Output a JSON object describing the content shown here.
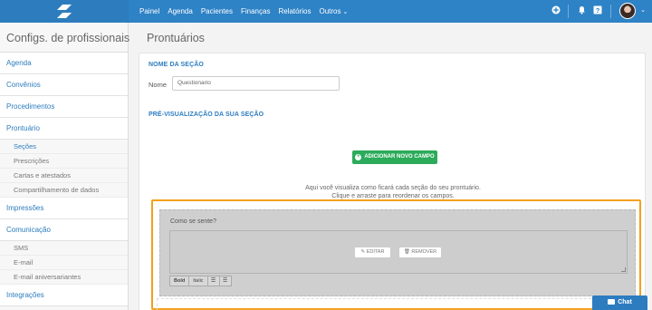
{
  "nav": {
    "items": [
      "Painel",
      "Agenda",
      "Pacientes",
      "Finanças",
      "Relatórios"
    ],
    "more_label": "Outros",
    "icons": [
      "plus-circle-icon",
      "bell-icon",
      "help-icon"
    ]
  },
  "sidebar": {
    "title": "Configs. de profissionais",
    "items": [
      {
        "label": "Agenda"
      },
      {
        "label": "Convênios"
      },
      {
        "label": "Procedimentos"
      },
      {
        "label": "Prontuário"
      },
      {
        "label": "Seções"
      },
      {
        "label": "Prescrições"
      },
      {
        "label": "Cartas e atestados"
      },
      {
        "label": "Compartilhamento de dados"
      },
      {
        "label": "Impressões"
      },
      {
        "label": "Comunicação"
      },
      {
        "label": "SMS"
      },
      {
        "label": "E-mail"
      },
      {
        "label": "E-mail aniversariantes"
      },
      {
        "label": "Integrações"
      }
    ]
  },
  "main": {
    "title": "Prontuários",
    "section_name_heading": "NOME DA SEÇÃO",
    "name_label": "Nome",
    "name_value": "Questionario",
    "preview_heading": "PRÉ-VISUALIZAÇÃO DA SUA SEÇÃO",
    "add_field_button": "ADICIONAR NOVO CAMPO",
    "hint_line1": "Aqui você visualiza como ficará cada seção do seu prontuário.",
    "hint_line2": "Clique e arraste para reordenar os campos.",
    "field": {
      "question": "Como se sente?",
      "edit_button": "EDITAR",
      "remove_button": "REMOVER",
      "toolbar": [
        "Bold",
        "Italic"
      ]
    }
  },
  "chat": {
    "label": "Chat"
  },
  "colors": {
    "accent": "#2e82c6",
    "success": "#2cab5a",
    "highlight": "#f4a01e"
  }
}
